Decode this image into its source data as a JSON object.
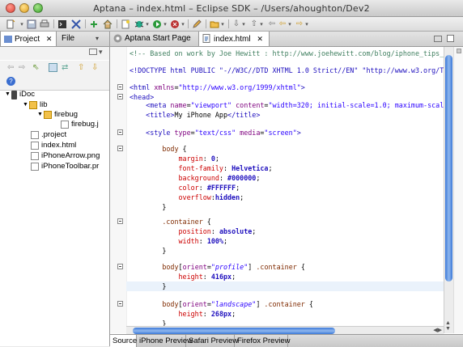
{
  "window": {
    "title": "Aptana – index.html – Eclipse SDK – /Users/ahoughton/Dev2"
  },
  "left_panel": {
    "tabs": [
      {
        "label": "Project",
        "close": "✕"
      },
      {
        "label": "File"
      }
    ],
    "tree": [
      {
        "label": "iDoc",
        "icon": "project-icon",
        "expanded": true
      },
      {
        "label": "lib",
        "icon": "folder-icon",
        "expanded": true
      },
      {
        "label": "firebug",
        "icon": "folder-icon",
        "expanded": true
      },
      {
        "label": "firebug.j",
        "icon": "js-file-icon"
      },
      {
        "label": ".project",
        "icon": "file-icon"
      },
      {
        "label": "index.html",
        "icon": "html-file-icon"
      },
      {
        "label": "iPhoneArrow.png",
        "icon": "image-file-icon"
      },
      {
        "label": "iPhoneToolbar.pr",
        "icon": "image-file-icon"
      }
    ]
  },
  "editor": {
    "tabs": [
      {
        "label": "Aptana Start Page",
        "icon": "aptana-icon"
      },
      {
        "label": "index.html",
        "icon": "html-file-icon",
        "close": "✕",
        "active": true
      }
    ],
    "bottom_tabs": [
      {
        "label": "Source",
        "active": true
      },
      {
        "label": "iPhone Preview"
      },
      {
        "label": "Safari Preview"
      },
      {
        "label": "Firefox Preview"
      }
    ]
  },
  "code": {
    "l1": "<!-- Based on work by Joe Hewitt : http://www.joehewitt.com/blog/iphone_tips_",
    "l2": "<!DOCTYPE html PUBLIC \"-//W3C//DTD XHTML 1.0 Strict//EN\" \"http://www.w3.org/TR",
    "l3a": "<html ",
    "l3b": "xmlns",
    "l3c": "=",
    "l3d": "\"http://www.w3.org/1999/xhtml\"",
    "l3e": ">",
    "l4": "<head>",
    "l5a": "    <meta ",
    "l5b": "name",
    "l5c": "=",
    "l5d": "\"viewport\"",
    "l5e": " content",
    "l5f": "=",
    "l5g": "\"width=320; initial-scale=1.0; maximum-scale",
    "l6a": "    <title>",
    "l6b": "My iPhone App",
    "l6c": "</title>",
    "l7a": "    <style ",
    "l7b": "type",
    "l7c": "=",
    "l7d": "\"text/css\"",
    "l7e": " media",
    "l7f": "=",
    "l7g": "\"screen\"",
    "l7h": ">",
    "l8a": "        body",
    "l8b": " {",
    "l9a": "            margin",
    "l9b": ": ",
    "l9c": "0",
    "l9d": ";",
    "l10a": "            font-family",
    "l10b": ": ",
    "l10c": "Helvetica",
    "l10d": ";",
    "l11a": "            background",
    "l11b": ": ",
    "l11c": "#000000",
    "l11d": ";",
    "l12a": "            color",
    "l12b": ": ",
    "l12c": "#FFFFFF",
    "l12d": ";",
    "l13a": "            overflow",
    "l13b": ":",
    "l13c": "hidden",
    "l13d": ";",
    "l14": "        }",
    "l15a": "        .container",
    "l15b": " {",
    "l16a": "            position",
    "l16b": ": ",
    "l16c": "absolute",
    "l16d": ";",
    "l17a": "            width",
    "l17b": ": ",
    "l17c": "100%",
    "l17d": ";",
    "l18": "        }",
    "l19a": "        body",
    "l19b": "[",
    "l19c": "orient",
    "l19d": "=",
    "l19e": "\"profile\"",
    "l19f": "]",
    "l19g": " .container",
    "l19h": " {",
    "l20a": "            height",
    "l20b": ": ",
    "l20c": "416px",
    "l20d": ";",
    "l21": "        }",
    "l22a": "        body",
    "l22b": "[",
    "l22c": "orient",
    "l22d": "=",
    "l22e": "\"landscape\"",
    "l22f": "]",
    "l22g": " .container",
    "l22h": " {",
    "l23a": "            height",
    "l23b": ": ",
    "l23c": "268px",
    "l23d": ";",
    "l24": "        }"
  }
}
